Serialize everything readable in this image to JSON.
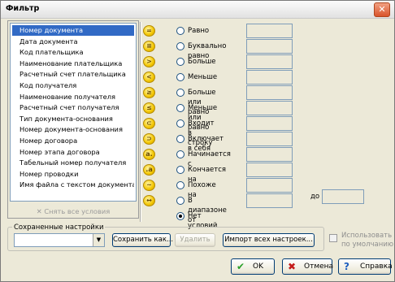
{
  "window": {
    "title": "Фильтр"
  },
  "fields": {
    "selected_index": 0,
    "items": [
      "Номер документа",
      "Дата документа",
      "Код плательщика",
      "Наименование плательщика",
      "Расчетный счет плательщика",
      "Код получателя",
      "Наименование получателя",
      "Расчетный счет получателя",
      "Тип документа-основания",
      "Номер документа-основания",
      "Номер договора",
      "Номер этапа договора",
      "Табельный номер получателя",
      "Номер проводки",
      "Имя файла с текстом документа"
    ],
    "clear_all_label": "Снять все условия"
  },
  "conditions": {
    "selected_index": 12,
    "items": [
      {
        "label": "Равно",
        "icon_glyph": "="
      },
      {
        "label": "Буквально равно",
        "icon_glyph": "≡"
      },
      {
        "label": "Больше",
        "icon_glyph": ">"
      },
      {
        "label": "Меньше",
        "icon_glyph": "<"
      },
      {
        "label": "Больше или равно",
        "icon_glyph": "≥"
      },
      {
        "label": "Меньше или равно",
        "icon_glyph": "≤"
      },
      {
        "label": "Входит в строку",
        "icon_glyph": "⊂"
      },
      {
        "label": "Включает в себя",
        "icon_glyph": "⊃"
      },
      {
        "label": "Начинается с",
        "icon_glyph": "a."
      },
      {
        "label": "Кончается на",
        "icon_glyph": ".a"
      },
      {
        "label": "Похоже на",
        "icon_glyph": "~"
      },
      {
        "label": "В диапазоне от",
        "icon_glyph": "↔"
      },
      {
        "label": "Нет условий",
        "icon_glyph": ""
      }
    ],
    "range_to_label": "до"
  },
  "saved": {
    "group_label": "Сохраненные настройки",
    "combo_value": "",
    "save_as_label": "Сохранить как...",
    "delete_label": "Удалить",
    "import_label": "Импорт всех настроек...",
    "use_default_label_line1": "Использовать",
    "use_default_label_line2": "по умолчанию"
  },
  "footer": {
    "ok_label": "OK",
    "cancel_label": "Отмена",
    "help_label": "Справка"
  }
}
